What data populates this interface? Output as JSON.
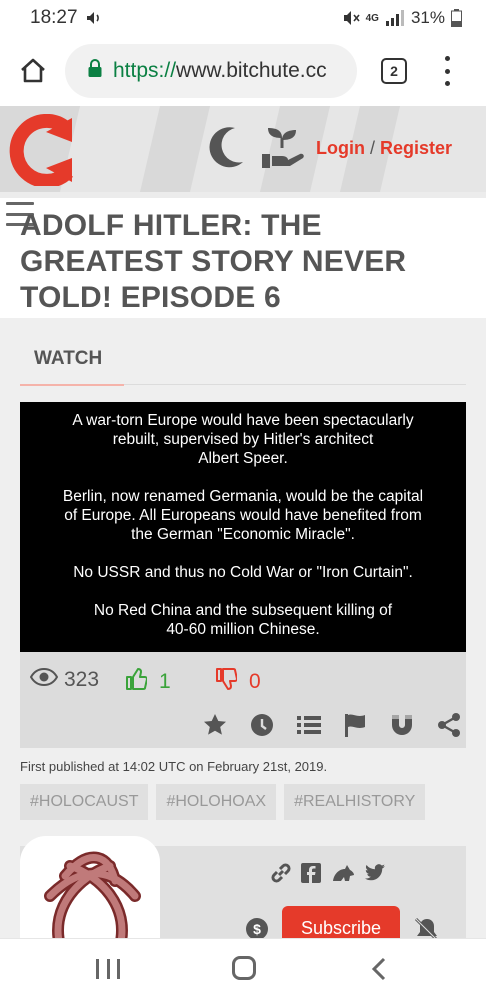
{
  "status_bar": {
    "time": "18:27",
    "network": "4G",
    "battery": "31%",
    "icons": [
      "volume-icon",
      "mute-icon",
      "signal-icon",
      "battery-icon"
    ]
  },
  "browser": {
    "url_scheme": "https://",
    "url_rest": "www.bitchute.cc",
    "tab_count": "2",
    "icons": [
      "home-icon",
      "lock-icon",
      "overflow-menu-icon"
    ]
  },
  "site_header": {
    "login": "Login",
    "separator": "/",
    "register": "Register",
    "accent_color": "#e53a2a",
    "icons": [
      "bitchute-logo",
      "moon-icon",
      "plant-hand-icon"
    ]
  },
  "video": {
    "title": "ADOLF HITLER: THE GREATEST STORY NEVER TOLD! EPISODE 6",
    "watch_tab": "WATCH",
    "frame_paragraphs": [
      "A war-torn Europe would have been spectacularly\nrebuilt, supervised by Hitler's architect\nAlbert Speer.",
      "Berlin, now renamed Germania, would be the capital\nof Europe. All Europeans would have benefited from\nthe German \"Economic Miracle\".",
      "No USSR and thus no Cold War or \"Iron Curtain\".",
      "No Red China and the subsequent killing of\n40-60 million Chinese."
    ],
    "views": "323",
    "likes": "1",
    "dislikes": "0",
    "action_icons": [
      "favorite-star-icon",
      "watch-later-clock-icon",
      "playlist-icon",
      "flag-icon",
      "magnet-icon",
      "share-icon"
    ],
    "published": "First published at 14:02 UTC on February 21st, 2019.",
    "tags": [
      "#HOLOCAUST",
      "#HOLOHOAX",
      "#REALHISTORY"
    ]
  },
  "channel": {
    "subscribe_label": "Subscribe",
    "dollar_symbol": "$",
    "share_icons": [
      "link-icon",
      "facebook-icon",
      "gab-icon",
      "twitter-icon"
    ],
    "icons": [
      "channel-avatar",
      "bell-off-icon"
    ]
  },
  "nav_bar": {
    "icons": [
      "recents-icon",
      "home-nav-icon",
      "back-icon"
    ]
  }
}
